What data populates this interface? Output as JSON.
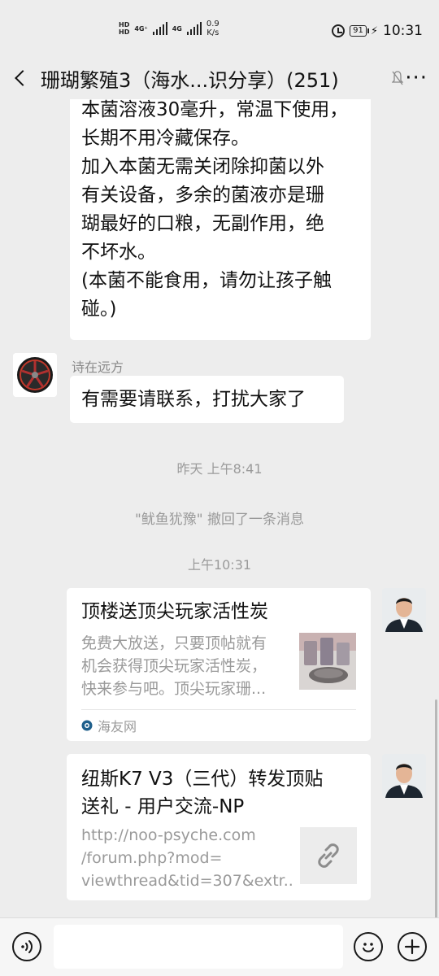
{
  "status_bar": {
    "hd1": "HD",
    "hd2": "HD",
    "net1": "4G⁺",
    "net2": "4G",
    "speed_value": "0.9",
    "speed_unit": "K/s",
    "battery": "91",
    "time": "10:31"
  },
  "header": {
    "title": "珊瑚繁殖3（海水...识分享）(251)",
    "more": "···"
  },
  "messages": {
    "first": {
      "lines": [
        "本菌溶液30毫升，常温下使用，",
        "长期不用冷藏保存。",
        "加入本菌无需关闭除抑菌以外",
        "有关设备，多余的菌液亦是珊",
        "瑚最好的口粮，无副作用，绝",
        "不坏水。",
        "(本菌不能食用，请勿让孩子触",
        "碰。)"
      ]
    },
    "second": {
      "sender": "诗在远方",
      "text": "有需要请联系，打扰大家了"
    },
    "timestamp1": "昨天 上午8:41",
    "recall": "\"鱿鱼犹豫\" 撤回了一条消息",
    "timestamp2": "上午10:31",
    "card1": {
      "title": "顶楼送顶尖玩家活性炭",
      "desc_lines": [
        "免费大放送，只要顶帖就有",
        "机会获得顶尖玩家活性炭，",
        "快来参与吧。顶尖玩家珊..."
      ],
      "source": "海友网"
    },
    "card2": {
      "title_lines": [
        "纽斯K7 V3（三代）转发顶贴",
        "送礼 - 用户交流-NP"
      ],
      "url_lines": [
        "http://noo-psyche.com",
        "/forum.php?mod=",
        "viewthread&tid=307&extr..."
      ]
    }
  },
  "input": {
    "placeholder": ""
  },
  "icons": {
    "back": "chevron-left-icon",
    "mute": "bell-muted-icon",
    "voice": "voice-icon",
    "emoji": "emoji-icon",
    "add": "plus-icon",
    "link": "link-icon"
  },
  "colors": {
    "background": "#ededed",
    "bubble": "#ffffff",
    "muted_text": "#9a9a9a"
  }
}
